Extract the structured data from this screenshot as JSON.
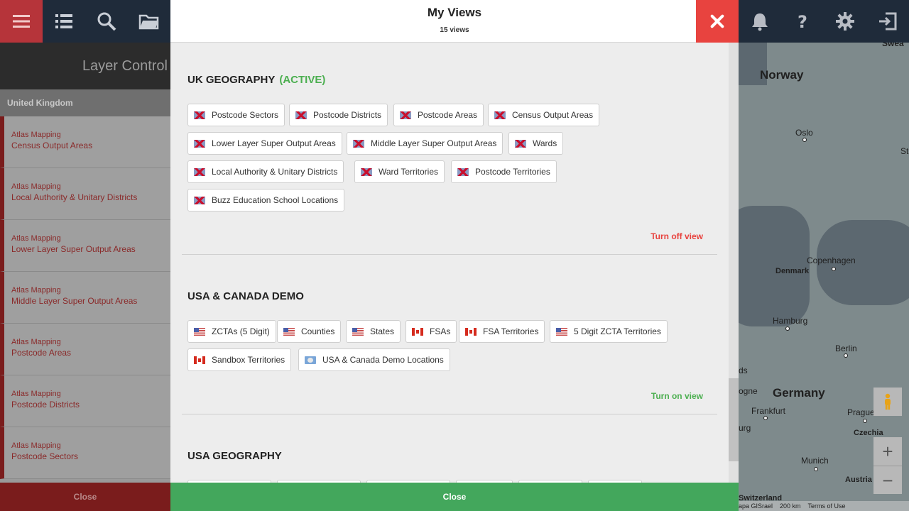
{
  "toolbar": {
    "menu_icon": "hamburger-menu-icon",
    "list_icon": "list-icon",
    "search_icon": "search-icon",
    "folder_icon": "folder-icon",
    "bell_icon": "bell-icon",
    "help_icon": "help-icon",
    "gear_icon": "gear-icon",
    "exit_icon": "exit-icon",
    "accent_color": "#b6343a"
  },
  "left_panel": {
    "title": "Layer Control",
    "country": "United Kingdom",
    "items": [
      {
        "category": "Atlas Mapping",
        "name": "Census Output Areas"
      },
      {
        "category": "Atlas Mapping",
        "name": "Local Authority & Unitary Districts"
      },
      {
        "category": "Atlas Mapping",
        "name": "Lower Layer Super Output Areas"
      },
      {
        "category": "Atlas Mapping",
        "name": "Middle Layer Super Output Areas"
      },
      {
        "category": "Atlas Mapping",
        "name": "Postcode Areas"
      },
      {
        "category": "Atlas Mapping",
        "name": "Postcode Districts"
      },
      {
        "category": "Atlas Mapping",
        "name": "Postcode Sectors"
      }
    ],
    "close_label": "Close"
  },
  "modal": {
    "title": "My Views",
    "subtitle": "15 views",
    "close_icon": "close-icon",
    "close_color": "#e8433f",
    "close_label": "Close",
    "close_button_color": "#43a75c",
    "sections": [
      {
        "title": "UK GEOGRAPHY",
        "status": "(ACTIVE)",
        "toggle_label": "Turn off view",
        "chips": [
          {
            "label": "Postcode Sectors",
            "flag": "uk-flag-icon"
          },
          {
            "label": "Postcode Districts",
            "flag": "uk-flag-icon"
          },
          {
            "label": "Postcode Areas",
            "flag": "uk-flag-icon"
          },
          {
            "label": "Census Output Areas",
            "flag": "uk-flag-icon"
          },
          {
            "label": "Lower Layer Super Output Areas",
            "flag": "uk-flag-icon"
          },
          {
            "label": "Middle Layer Super Output Areas",
            "flag": "uk-flag-icon"
          },
          {
            "label": "Wards",
            "flag": "uk-flag-icon"
          },
          {
            "label": "Local Authority & Unitary Districts",
            "flag": "uk-flag-icon"
          },
          {
            "label": "Ward Territories",
            "flag": "uk-flag-icon"
          },
          {
            "label": "Postcode Territories",
            "flag": "uk-flag-icon"
          },
          {
            "label": "Buzz Education School Locations",
            "flag": "uk-flag-icon"
          }
        ]
      },
      {
        "title": "USA & CANADA DEMO",
        "status": "",
        "toggle_label": "Turn on view",
        "chips": [
          {
            "label": "ZCTAs (5 Digit)",
            "flag": "us-flag-icon"
          },
          {
            "label": "Counties",
            "flag": "us-flag-icon"
          },
          {
            "label": "States",
            "flag": "us-flag-icon"
          },
          {
            "label": "FSAs",
            "flag": "canada-flag-icon"
          },
          {
            "label": "FSA Territories",
            "flag": "canada-flag-icon"
          },
          {
            "label": "5 Digit ZCTA Territories",
            "flag": "us-flag-icon"
          },
          {
            "label": "Sandbox Territories",
            "flag": "canada-flag-icon"
          },
          {
            "label": "USA & Canada Demo Locations",
            "flag": "world-flag-icon"
          }
        ]
      },
      {
        "title": "USA GEOGRAPHY",
        "status": "",
        "toggle_label": "",
        "chips": []
      }
    ]
  },
  "map": {
    "labels": {
      "norway": "Norway",
      "oslo": "Oslo",
      "copenhagen": "Copenhagen",
      "denmark": "Denmark",
      "hamburg": "Hamburg",
      "berlin": "Berlin",
      "germany": "Germany",
      "frankfurt": "Frankfurt",
      "prague": "Prague",
      "czechia": "Czechia",
      "munich": "Munich",
      "austria": "Austria",
      "switzerland": "Switzerland",
      "top_edge": "Swea",
      "right_edge": "St",
      "left_edge_1": "ds",
      "left_edge_2": "ogne",
      "left_edge_3": "urg"
    },
    "pegman_icon": "pegman-icon",
    "zoom_in_label": "+",
    "zoom_out_label": "−",
    "footer_attribution": "apa GISrael",
    "footer_scale": "200 km",
    "footer_terms": "Terms of Use"
  }
}
